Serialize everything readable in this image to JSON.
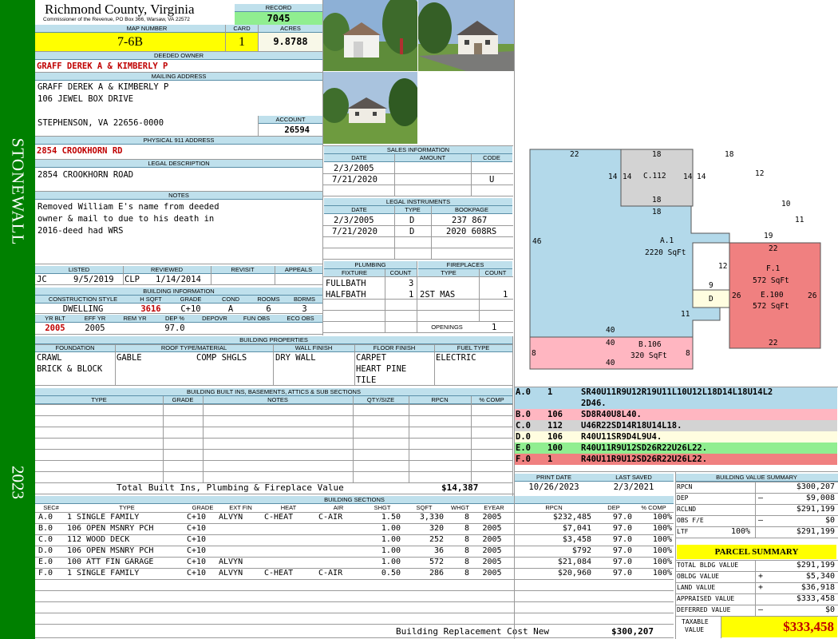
{
  "county": "Richmond County, Virginia",
  "commissioner": "Commissioner of the Revenue, PO Box 366, Warsaw, VA 22572",
  "record": {
    "label": "RECORD",
    "value": "7045"
  },
  "map_number": {
    "label": "MAP NUMBER",
    "value": "7-6B"
  },
  "card": {
    "label": "CARD",
    "value": "1"
  },
  "acres": {
    "label": "ACRES",
    "value": "9.8788"
  },
  "deeded_owner": {
    "label": "DEEDED OWNER",
    "value": "GRAFF DEREK A & KIMBERLY P"
  },
  "mailing": {
    "label": "MAILING ADDRESS",
    "line1": "GRAFF DEREK A & KIMBERLY P",
    "line2": "106 JEWEL BOX DRIVE",
    "line3": "STEPHENSON, VA 22656-0000"
  },
  "account": {
    "label": "ACCOUNT",
    "value": "26594"
  },
  "physical": {
    "label": "PHYSICAL 911 ADDRESS",
    "value": "2854 CROOKHORN RD"
  },
  "legal": {
    "label": "LEGAL DESCRIPTION",
    "value": "2854 CROOKHORN ROAD"
  },
  "notes": {
    "label": "NOTES",
    "line1": "Removed William E's name from deeded",
    "line2": "owner & mail to due to his death in",
    "line3": "2016-deed had WRS"
  },
  "listing": {
    "headers": [
      "LISTED",
      "REVIEWED",
      "REVISIT",
      "APPEALS"
    ],
    "listed_by": "JC",
    "listed_date": "9/5/2019",
    "reviewed_by": "CLP",
    "reviewed_date": "1/14/2014"
  },
  "building_info": {
    "label": "BUILDING INFORMATION",
    "headers": [
      "CONSTRUCTION STYLE",
      "H SQFT",
      "GRADE",
      "COND",
      "ROOMS",
      "BDRMS"
    ],
    "values": [
      "DWELLING",
      "3616",
      "C+10",
      "A",
      "6",
      "3"
    ],
    "headers2": [
      "YR BLT",
      "EFF YR",
      "REM YR",
      "DEP %",
      "DEPOVR",
      "FUN OBS",
      "ECO OBS"
    ],
    "values2": [
      "2005",
      "2005",
      "",
      "97.0",
      "",
      "",
      ""
    ]
  },
  "sales": {
    "label": "SALES INFORMATION",
    "headers": [
      "DATE",
      "AMOUNT",
      "CODE"
    ],
    "rows": [
      {
        "date": "2/3/2005",
        "amount": "",
        "code": ""
      },
      {
        "date": "7/21/2020",
        "amount": "",
        "code": "U"
      }
    ]
  },
  "legal_instruments": {
    "label": "LEGAL INSTRUMENTS",
    "headers": [
      "DATE",
      "TYPE",
      "BOOKPAGE"
    ],
    "rows": [
      {
        "date": "2/3/2005",
        "type": "D",
        "bookpage": "237 867"
      },
      {
        "date": "7/21/2020",
        "type": "D",
        "bookpage": "2020 608RS"
      }
    ]
  },
  "plumbing": {
    "label": "PLUMBING",
    "headers": [
      "FIXTURE",
      "COUNT"
    ],
    "rows": [
      {
        "fixture": "FULLBATH",
        "count": "3"
      },
      {
        "fixture": "HALFBATH",
        "count": "1"
      }
    ]
  },
  "fireplaces": {
    "label": "FIREPLACES",
    "headers": [
      "TYPE",
      "COUNT"
    ],
    "rows": [
      {
        "type": "2ST MAS",
        "count": "1"
      }
    ],
    "openings_label": "OPENINGS",
    "openings": "1"
  },
  "building_properties": {
    "label": "BUILDING PROPERTIES",
    "headers": [
      "FOUNDATION",
      "ROOF TYPE/MATERIAL",
      "WALL FINISH",
      "FLOOR FINISH",
      "FUEL TYPE"
    ],
    "foundation1": "CRAWL",
    "foundation2": "BRICK & BLOCK",
    "roof_type": "GABLE",
    "roof_material": "COMP SHGLS",
    "wall": "DRY WALL",
    "floor1": "CARPET",
    "floor2": "HEART PINE",
    "floor3": "TILE",
    "fuel": "ELECTRIC"
  },
  "builtins": {
    "label": "BUILDING BUILT INS, BASEMENTS, ATTICS & SUB SECTIONS",
    "headers": [
      "TYPE",
      "GRADE",
      "NOTES",
      "QTY/SIZE",
      "RPCN",
      "% COMP"
    ],
    "total_label": "Total Built Ins, Plumbing & Fireplace Value",
    "total_value": "$14,387"
  },
  "sketch": {
    "labels": {
      "a": "A.1",
      "a_sqft": "2220 SqFt",
      "b": "B.106",
      "b_sqft": "320 SqFt",
      "c": "C.112",
      "d": "D",
      "e": "E.100",
      "e_sqft": "572 SqFt",
      "f": "F.1",
      "f_sqft": "572 SqFt"
    },
    "dims": [
      "22",
      "18",
      "18",
      "14",
      "14",
      "14",
      "14",
      "12",
      "18",
      "18",
      "10",
      "11",
      "19",
      "22",
      "46",
      "12",
      "9",
      "26",
      "26",
      "11",
      "40",
      "40",
      "8",
      "8",
      "40",
      "22"
    ]
  },
  "sketch_defs": [
    {
      "sec": "A.0",
      "code": "1",
      "text": "SR40U11R9U12R19U11L10U12L18D14L18U14L2",
      "text2": "2D46.",
      "color": "#b3d9ea"
    },
    {
      "sec": "B.0",
      "code": "106",
      "text": "SD8R40U8L40.",
      "color": "#ffb6c1"
    },
    {
      "sec": "C.0",
      "code": "112",
      "text": "U46R22SD14R18U14L18.",
      "color": "#d3d3d3"
    },
    {
      "sec": "D.0",
      "code": "106",
      "text": "R40U11SR9D4L9U4.",
      "color": "#fffde0"
    },
    {
      "sec": "E.0",
      "code": "100",
      "text": "R40U11R9U12SD26R22U26L22.",
      "color": "#90ee90"
    },
    {
      "sec": "F.0",
      "code": "1",
      "text": "R40U11R9U12SD26R22U26L22.",
      "color": "#f08080"
    }
  ],
  "print_info": {
    "print_label": "PRINT DATE",
    "print_date": "10/26/2023",
    "saved_label": "LAST SAVED",
    "saved_date": "2/3/2021"
  },
  "building_sections": {
    "label": "BUILDING SECTIONS",
    "headers": [
      "SEC#",
      "TYPE",
      "GRADE",
      "EXT FIN",
      "HEAT",
      "AIR",
      "SHGT",
      "SQFT",
      "WHGT",
      "EYEAR",
      "RPCN",
      "DEP",
      "% COMP"
    ],
    "rows": [
      {
        "sec": "A.0",
        "type": "1 SINGLE FAMILY",
        "grade": "C+10",
        "ext": "ALVYN",
        "heat": "C-HEAT",
        "air": "C-AIR",
        "shgt": "1.50",
        "sqft": "3,330",
        "whgt": "8",
        "eyear": "2005",
        "rpcn": "$232,485",
        "dep": "97.0",
        "comp": "100%"
      },
      {
        "sec": "B.0",
        "type": "106 OPEN MSNRY PCH",
        "grade": "C+10",
        "ext": "",
        "heat": "",
        "air": "",
        "shgt": "1.00",
        "sqft": "320",
        "whgt": "8",
        "eyear": "2005",
        "rpcn": "$7,041",
        "dep": "97.0",
        "comp": "100%"
      },
      {
        "sec": "C.0",
        "type": "112 WOOD DECK",
        "grade": "C+10",
        "ext": "",
        "heat": "",
        "air": "",
        "shgt": "1.00",
        "sqft": "252",
        "whgt": "8",
        "eyear": "2005",
        "rpcn": "$3,458",
        "dep": "97.0",
        "comp": "100%"
      },
      {
        "sec": "D.0",
        "type": "106 OPEN MSNRY PCH",
        "grade": "C+10",
        "ext": "",
        "heat": "",
        "air": "",
        "shgt": "1.00",
        "sqft": "36",
        "whgt": "8",
        "eyear": "2005",
        "rpcn": "$792",
        "dep": "97.0",
        "comp": "100%"
      },
      {
        "sec": "E.0",
        "type": "100 ATT FIN GARAGE",
        "grade": "C+10",
        "ext": "ALVYN",
        "heat": "",
        "air": "",
        "shgt": "1.00",
        "sqft": "572",
        "whgt": "8",
        "eyear": "2005",
        "rpcn": "$21,084",
        "dep": "97.0",
        "comp": "100%"
      },
      {
        "sec": "F.0",
        "type": "1 SINGLE FAMILY",
        "grade": "C+10",
        "ext": "ALVYN",
        "heat": "C-HEAT",
        "air": "C-AIR",
        "shgt": "0.50",
        "sqft": "286",
        "whgt": "8",
        "eyear": "2005",
        "rpcn": "$20,960",
        "dep": "97.0",
        "comp": "100%"
      }
    ],
    "total_label": "Building Replacement Cost New",
    "total_value": "$300,207"
  },
  "building_value_summary": {
    "label": "BUILDING VALUE SUMMARY",
    "rpcn_label": "RPCN",
    "rpcn": "$300,207",
    "dep_label": "DEP",
    "dep_sign": "–",
    "dep": "$9,008",
    "rclnd_label": "RCLND",
    "rclnd": "$291,199",
    "obs_label": "OBS F/E",
    "obs_sign": "–",
    "obs": "$0",
    "ltf_label": "LTF",
    "ltf_pct": "100%",
    "ltf": "$291,199"
  },
  "parcel_summary": {
    "label": "PARCEL SUMMARY",
    "total_bldg_label": "TOTAL BLDG VALUE",
    "total_bldg": "$291,199",
    "obldg_label": "OBLDG VALUE",
    "obldg_sign": "+",
    "obldg": "$5,340",
    "land_label": "LAND VALUE",
    "land_sign": "+",
    "land": "$36,918",
    "appraised_label": "APPRAISED VALUE",
    "appraised": "$333,458",
    "deferred_label": "DEFERRED VALUE",
    "deferred_sign": "–",
    "deferred": "$0",
    "taxable_label1": "TAXABLE",
    "taxable_label2": "VALUE",
    "taxable": "$333,458"
  },
  "sidebar": {
    "district": "STONEWALL",
    "year": "2023"
  }
}
